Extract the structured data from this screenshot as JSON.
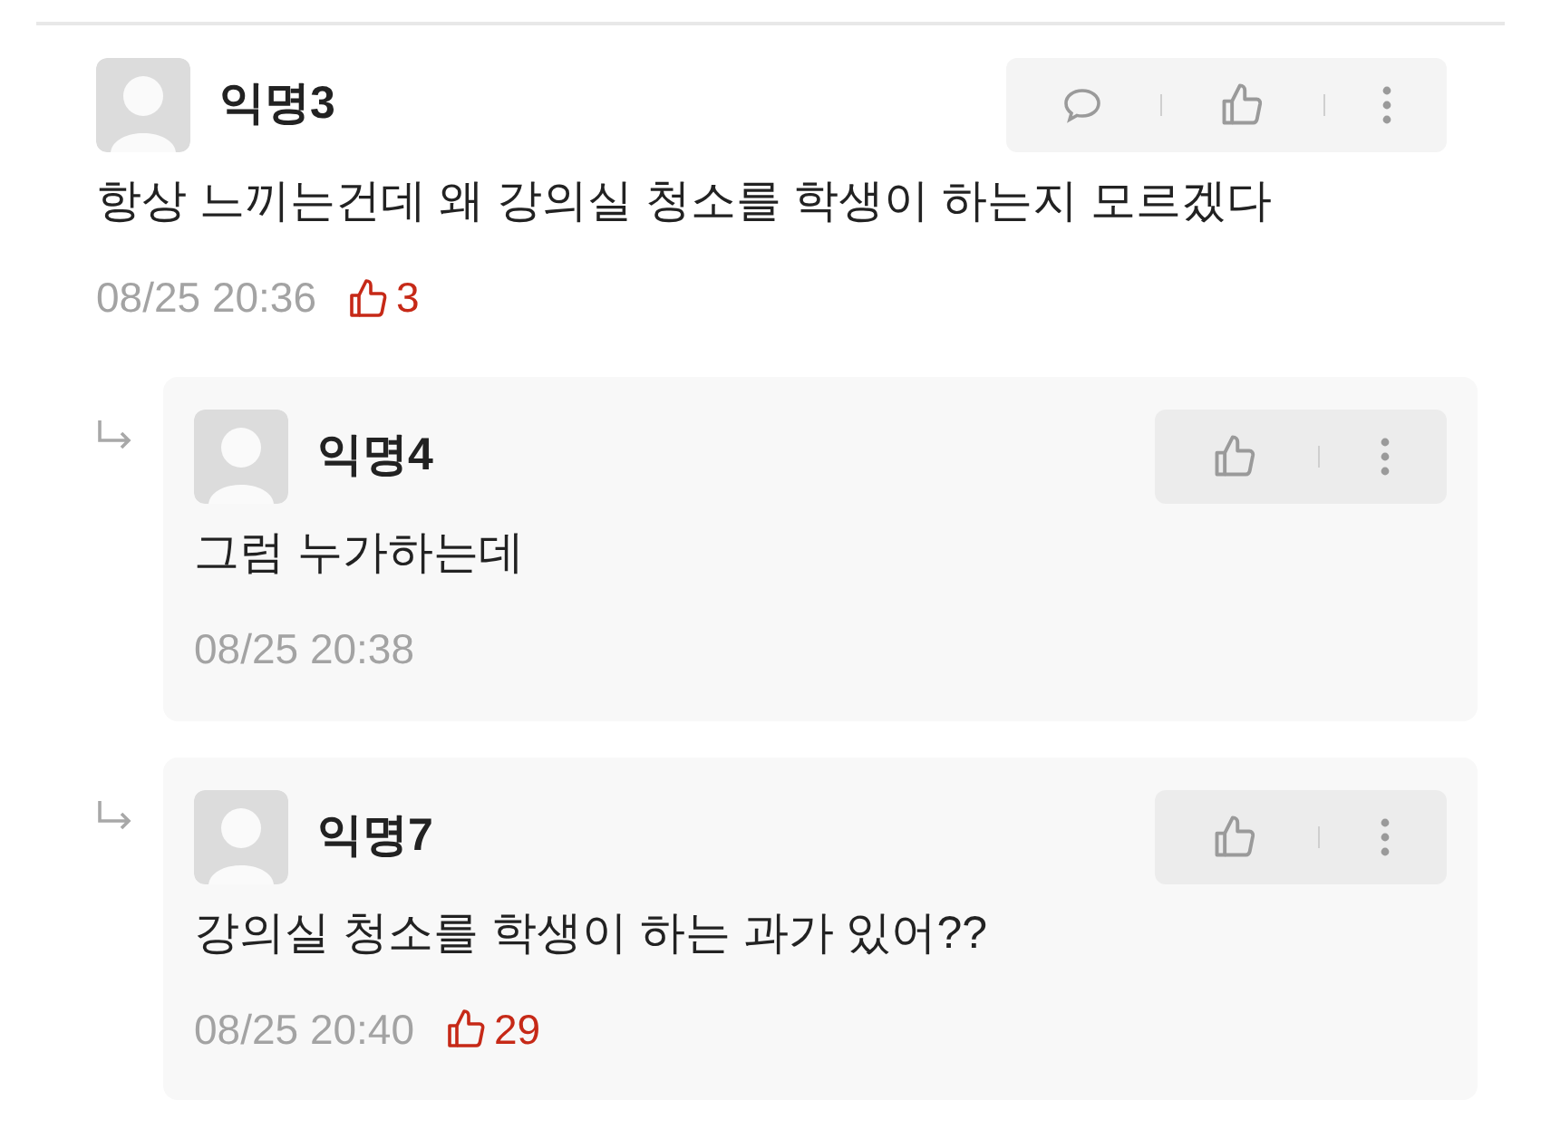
{
  "comments": [
    {
      "kind": "comment",
      "author": "익명3",
      "text": "항상 느끼는건데 왜 강의실 청소를 학생이 하는지 모르겠다",
      "time": "08/25 20:36",
      "likes": "3"
    },
    {
      "kind": "reply",
      "author": "익명4",
      "text": "그럼 누가하는데",
      "time": "08/25 20:38"
    },
    {
      "kind": "reply",
      "author": "익명7",
      "text": "강의실 청소를 학생이 하는 과가 있어??",
      "time": "08/25 20:40",
      "likes": "29"
    }
  ]
}
